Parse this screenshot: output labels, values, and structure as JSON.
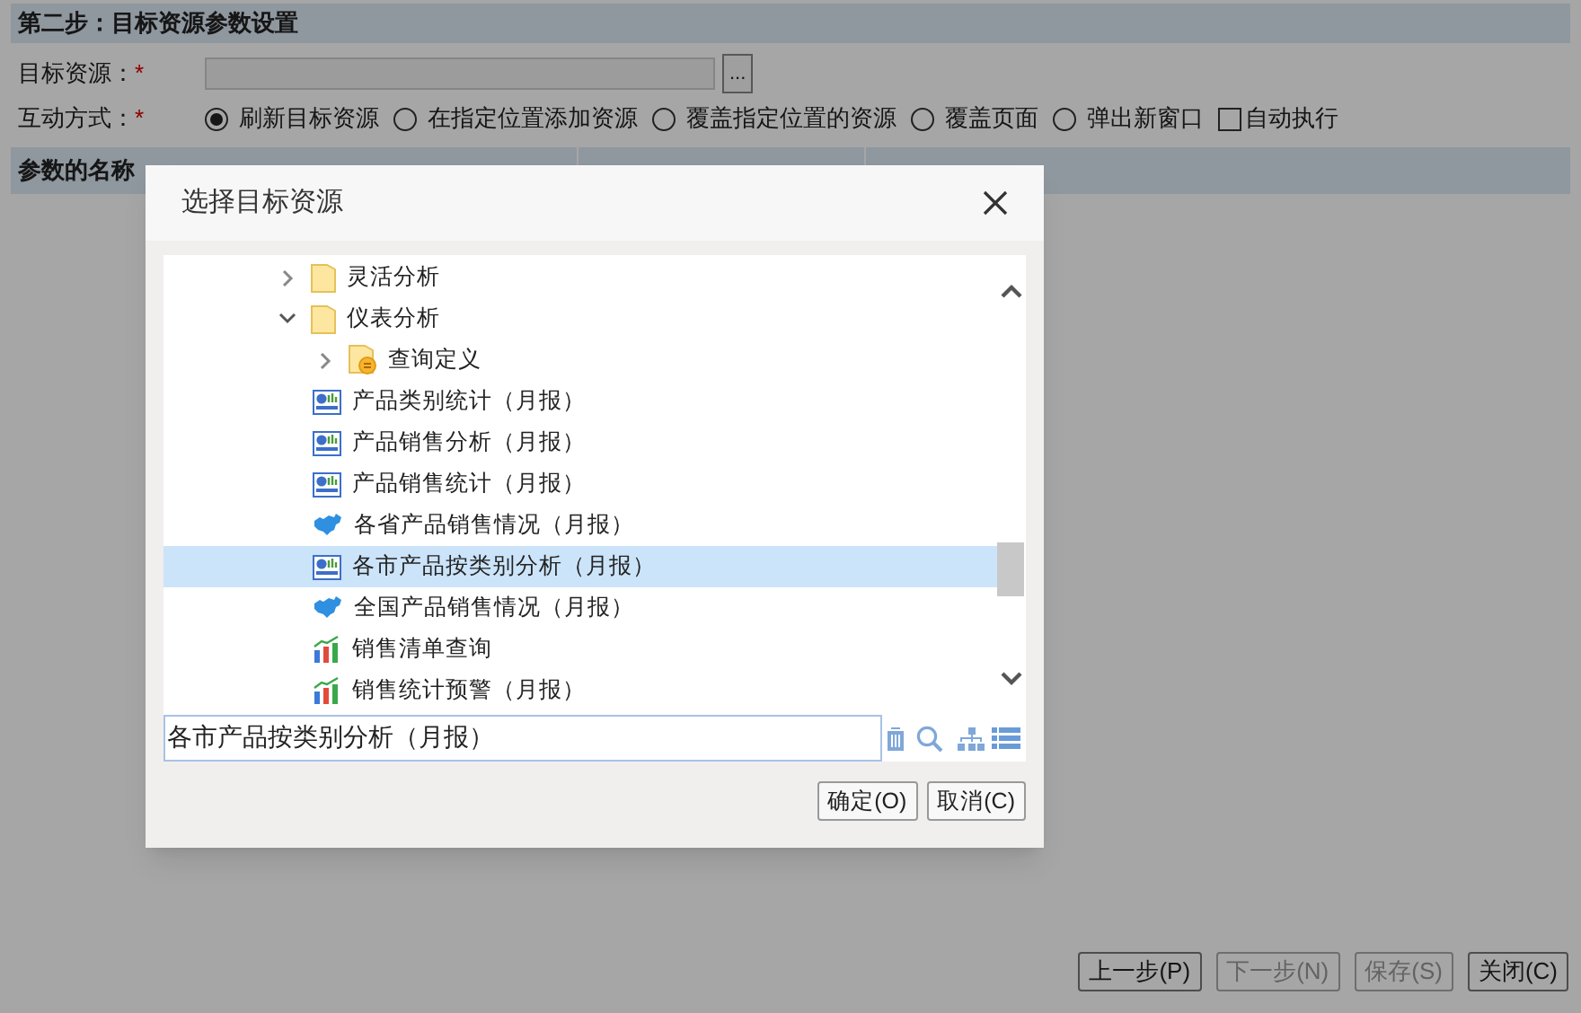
{
  "page": {
    "step_title": "第二步：目标资源参数设置",
    "target_resource": {
      "label": "目标资源：",
      "required_mark": "*",
      "value_button": "..."
    },
    "interaction": {
      "label": "互动方式：",
      "required_mark": "*",
      "options": [
        {
          "label": "刷新目标资源",
          "selected": true
        },
        {
          "label": "在指定位置添加资源",
          "selected": false
        },
        {
          "label": "覆盖指定位置的资源",
          "selected": false
        },
        {
          "label": "覆盖页面",
          "selected": false
        },
        {
          "label": "弹出新窗口",
          "selected": false
        }
      ],
      "auto_execute": {
        "label": "自动执行",
        "checked": false
      }
    },
    "table": {
      "columns": [
        "参数的名称"
      ]
    },
    "buttons": [
      {
        "label": "上一步(P)",
        "disabled": false
      },
      {
        "label": "下一步(N)",
        "disabled": true
      },
      {
        "label": "保存(S)",
        "disabled": true
      },
      {
        "label": "关闭(C)",
        "disabled": false
      }
    ]
  },
  "dialog": {
    "title": "选择目标资源",
    "tree": [
      {
        "kind": "folder",
        "label": "灵活分析",
        "expanded": false,
        "selected": false
      },
      {
        "kind": "folder",
        "label": "仪表分析",
        "expanded": true,
        "selected": false,
        "children": [
          {
            "kind": "query-folder",
            "label": "查询定义",
            "expanded": false,
            "selected": false
          },
          {
            "kind": "dashboard",
            "label": "产品类别统计（月报）",
            "selected": false
          },
          {
            "kind": "dashboard",
            "label": "产品销售分析（月报）",
            "selected": false
          },
          {
            "kind": "dashboard",
            "label": "产品销售统计（月报）",
            "selected": false
          },
          {
            "kind": "map",
            "label": "各省产品销售情况（月报）",
            "selected": false
          },
          {
            "kind": "dashboard",
            "label": "各市产品按类别分析（月报）",
            "selected": true
          },
          {
            "kind": "map",
            "label": "全国产品销售情况（月报）",
            "selected": false
          },
          {
            "kind": "chart",
            "label": "销售清单查询",
            "selected": false
          },
          {
            "kind": "chart",
            "label": "销售统计预警（月报）",
            "selected": false
          }
        ]
      }
    ],
    "path_value": "各市产品按类别分析（月报）",
    "buttons": [
      "确定(O)",
      "取消(C)"
    ]
  }
}
